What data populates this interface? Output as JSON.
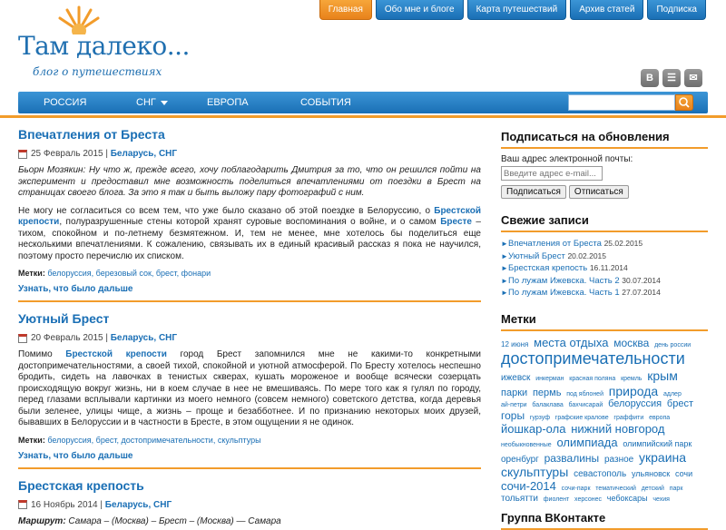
{
  "header": {
    "logo_title": "Там далеко...",
    "logo_subtitle": "блог о путешествиях"
  },
  "topnav": [
    {
      "label": "Главная",
      "active": true
    },
    {
      "label": "Обо мне и блоге",
      "active": false
    },
    {
      "label": "Карта путешествий",
      "active": false
    },
    {
      "label": "Архив статей",
      "active": false
    },
    {
      "label": "Подписка",
      "active": false
    }
  ],
  "social": [
    {
      "icon": "vk-icon",
      "glyph": "B"
    },
    {
      "icon": "rss-icon",
      "glyph": "☰"
    },
    {
      "icon": "email-icon",
      "glyph": "✉"
    }
  ],
  "mainnav": {
    "items": [
      {
        "label": "РОССИЯ"
      },
      {
        "label": "СНГ"
      },
      {
        "label": "ЕВРОПА"
      },
      {
        "label": "СОБЫТИЯ"
      }
    ],
    "search_placeholder": ""
  },
  "posts": [
    {
      "title": "Впечатления от Бреста",
      "date": "25 Февраль 2015",
      "categories": "Беларусь, СНГ",
      "intro": "Бьорн Мозякин: Ну что ж, прежде всего, хочу поблагодарить Дмитрия за то,  что он решился пойти на эксперимент и предоставил мне возможность поделиться впечатлениями от поездки в Брест на страницах своего блога. За это я так и быть выложу пару фотографий с ним.",
      "body_a": "Не могу не согласиться со всем тем, что уже было сказано об этой поездке в Белоруссию, о ",
      "body_link1": "Брестской крепости",
      "body_b": ", полуразрушенные стены которой хранят суровые воспоминания о войне, и о самом ",
      "body_link2": "Бресте",
      "body_c": " – тихом, спокойном и по-летнему безмятежном. И, тем не менее, мне хотелось бы поделиться еще несколькими впечатлениями. К сожалению, связывать их в единый красивый рассказ я пока не научился, поэтому просто перечислю их списком.",
      "tags_label": "Метки:",
      "tags": "белоруссия, березовый сок, брест, фонари",
      "readmore": "Узнать, что было дальше"
    },
    {
      "title": "Уютный Брест",
      "date": "20 Февраль 2015",
      "categories": "Беларусь, СНГ",
      "body_a": "Помимо ",
      "body_link1": "Брестской крепости",
      "body_b": " город Брест запомнился мне не какими-то конкретными достопримечательностями, а своей тихой, спокойной и уютной атмосферой. По Бресту хотелось неспешно бродить, сидеть на лавочках в тенистых скверах, кушать мороженое и вообще всячески созерцать происходящую вокруг жизнь, ни в коем случае в нее не вмешиваясь. По мере того как я гулял по городу, перед глазами всплывали картинки из моего немного (совсем немного) советского детства, когда деревья были зеленее, улицы чище, а жизнь – проще и безабботнее. И по признанию некоторых моих друзей, бывавших в Белоруссии и в частности в Бресте, в этом ощущении я не одинок.",
      "tags_label": "Метки:",
      "tags": "белоруссия, брест, достопримечательности, скульптуры",
      "readmore": "Узнать, что было дальше"
    },
    {
      "title": "Брестская крепость",
      "date": "16 Ноябрь 2014",
      "categories": "Беларусь, СНГ",
      "route_label": "Маршрут:",
      "route": " Самара – (Москва) – Брест – (Москва) — Самара"
    }
  ],
  "sidebar": {
    "subscribe": {
      "title": "Подписаться на обновления",
      "label": "Ваш адрес электронной почты:",
      "placeholder": "Введите адрес e-mail...",
      "subscribe_btn": "Подписаться",
      "unsubscribe_btn": "Отписаться"
    },
    "recent": {
      "title": "Свежие записи",
      "items": [
        {
          "title": "Впечатления от Бреста",
          "date": "25.02.2015"
        },
        {
          "title": "Уютный Брест",
          "date": "20.02.2015"
        },
        {
          "title": "Брестская крепость",
          "date": "16.11.2014"
        },
        {
          "title": "По лужам Ижевска. Часть 2",
          "date": "30.07.2014"
        },
        {
          "title": "По лужам Ижевска. Часть 1",
          "date": "27.07.2014"
        }
      ]
    },
    "tags": {
      "title": "Метки",
      "items": [
        {
          "t": "12 июня",
          "s": 8
        },
        {
          "t": "места отдыха",
          "s": 13
        },
        {
          "t": "москва",
          "s": 12
        },
        {
          "t": "день россии",
          "s": 7
        },
        {
          "t": "достопримечательности",
          "s": 18
        },
        {
          "t": "ижевск",
          "s": 10
        },
        {
          "t": "инкерман",
          "s": 7
        },
        {
          "t": "красная поляна",
          "s": 7
        },
        {
          "t": "кремль",
          "s": 7
        },
        {
          "t": "крым",
          "s": 14
        },
        {
          "t": "парки",
          "s": 11
        },
        {
          "t": "пермь",
          "s": 11
        },
        {
          "t": "под яблоней",
          "s": 7
        },
        {
          "t": "природа",
          "s": 14
        },
        {
          "t": "адлер",
          "s": 7
        },
        {
          "t": "ай-петри",
          "s": 7
        },
        {
          "t": "балаклава",
          "s": 7
        },
        {
          "t": "бахчисарай",
          "s": 7
        },
        {
          "t": "белоруссия",
          "s": 11
        },
        {
          "t": "брест",
          "s": 11
        },
        {
          "t": "горы",
          "s": 12
        },
        {
          "t": "гурзуф",
          "s": 7
        },
        {
          "t": "графские кралове",
          "s": 7
        },
        {
          "t": "граффити",
          "s": 7
        },
        {
          "t": "европа",
          "s": 7
        },
        {
          "t": "йошкар-ола",
          "s": 13
        },
        {
          "t": "нижний новгород",
          "s": 13
        },
        {
          "t": "необыкновенные",
          "s": 7
        },
        {
          "t": "олимпиада",
          "s": 13
        },
        {
          "t": "олимпийский парк",
          "s": 9
        },
        {
          "t": "оренбург",
          "s": 10
        },
        {
          "t": "развалины",
          "s": 12
        },
        {
          "t": "разное",
          "s": 10
        },
        {
          "t": "украина",
          "s": 14
        },
        {
          "t": "скульптуры",
          "s": 14
        },
        {
          "t": "севастополь",
          "s": 10
        },
        {
          "t": "ульяновск",
          "s": 9
        },
        {
          "t": "сочи",
          "s": 9
        },
        {
          "t": "сочи-2014",
          "s": 13
        },
        {
          "t": "сочи-парк",
          "s": 7
        },
        {
          "t": "тематический",
          "s": 7
        },
        {
          "t": "детский",
          "s": 7
        },
        {
          "t": "парк",
          "s": 7
        },
        {
          "t": "тольятти",
          "s": 10
        },
        {
          "t": "фиолент",
          "s": 7
        },
        {
          "t": "херсонес",
          "s": 7
        },
        {
          "t": "чебоксары",
          "s": 9
        },
        {
          "t": "чехия",
          "s": 7
        }
      ]
    },
    "vk": {
      "title": "Группа ВКонтакте"
    }
  },
  "colors": {
    "brand_blue": "#1a6fb5",
    "accent_orange": "#f29c2b"
  }
}
